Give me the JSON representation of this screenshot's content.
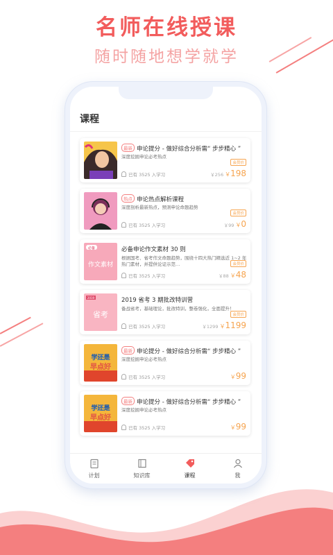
{
  "banner": {
    "headline": "名师在线授课",
    "subline": "随时随地想学就学"
  },
  "screen": {
    "title": "课程"
  },
  "courses": [
    {
      "tag": "最新",
      "title": "申论提分 - 做好综合分析需“ 步步精心 ”",
      "desc": "深度挖掘申论必考热点",
      "students": "已有 3525 入学习",
      "vip": "会员价",
      "old_price": "￥256",
      "price": "198",
      "thumb": "cartoon-woman"
    },
    {
      "tag": "热点",
      "title": "申论热点解析课程",
      "desc": "深度剖析最新热点，预测申论命题趋势",
      "students": "已有 3525 入学习",
      "vip": "会员价",
      "old_price": "￥99",
      "price": "0",
      "thumb": "headset-woman"
    },
    {
      "tag": "",
      "title": "必备申论作文素材 30 则",
      "desc": "根据国考、省考作文命题趋势，围绕十四大热门精选近 1~2 年热门素材，并提供论证示范…",
      "students": "已有 3525 入学习",
      "vip": "会员价",
      "old_price": "￥88",
      "price": "48",
      "thumb": "作文素材"
    },
    {
      "tag": "",
      "title": "2019 省考 3 期批改特训营",
      "desc": "备战省考，基础理论，批改特训，整卷强化，全面提升！",
      "students": "已有 3525 入学习",
      "vip": "会员价",
      "old_price": "￥1299",
      "price": "1199",
      "thumb": "省考"
    },
    {
      "tag": "最新",
      "title": "申论提分 - 做好综合分析需“ 步步精心 ”",
      "desc": "深度挖掘申论必考热点",
      "students": "已有 3525 入学习",
      "vip": "",
      "old_price": "",
      "price": "99",
      "thumb": "学还是早点好"
    },
    {
      "tag": "最新",
      "title": "申论提分 - 做好综合分析需“ 步步精心 ”",
      "desc": "深度挖掘申论必考热点",
      "students": "已有 3525 入学习",
      "vip": "",
      "old_price": "",
      "price": "99",
      "thumb": "学还是早点好"
    }
  ],
  "currency": "￥",
  "thumb_text": {
    "badge": "必备",
    "material": "作文素材",
    "year": "2019",
    "exam": "省考",
    "slogan1": "学还是",
    "slogan2": "早点好"
  },
  "tabs": [
    {
      "label": "计划",
      "icon": "clipboard-icon"
    },
    {
      "label": "知识库",
      "icon": "book-icon"
    },
    {
      "label": "课程",
      "icon": "tag-icon",
      "active": true
    },
    {
      "label": "我",
      "icon": "person-icon"
    }
  ],
  "colors": {
    "accent": "#f25c5c",
    "price": "#f6a44f"
  }
}
